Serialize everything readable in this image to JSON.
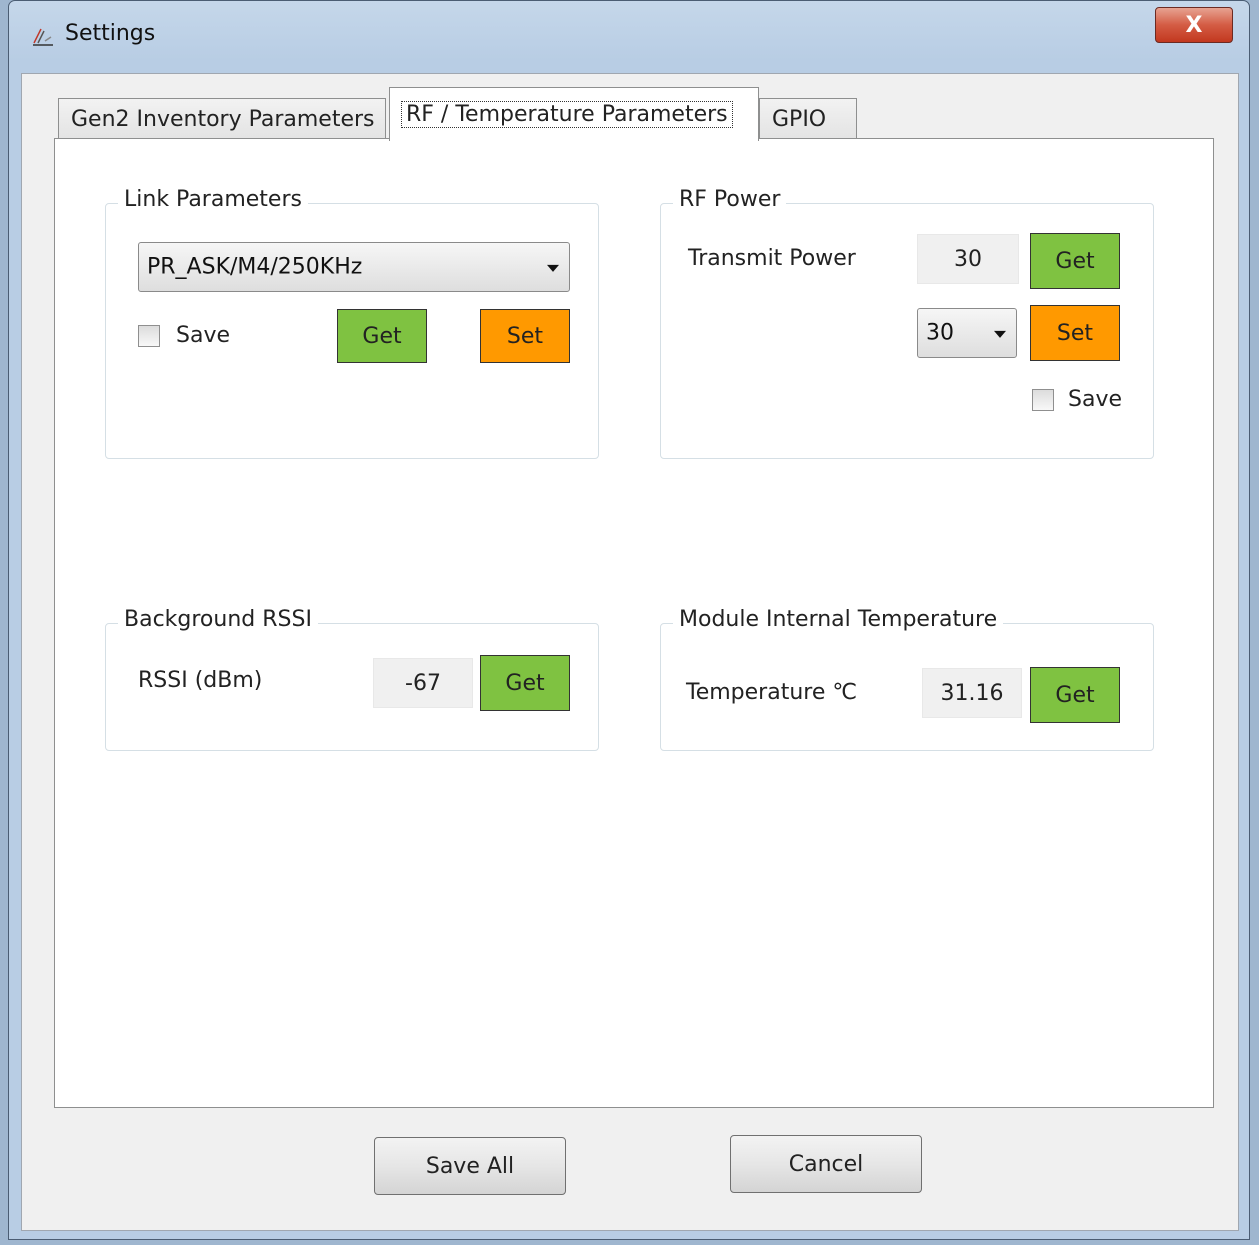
{
  "window": {
    "title": "Settings",
    "close_label": "X"
  },
  "tabs": [
    {
      "label": "Gen2 Inventory Parameters",
      "active": false
    },
    {
      "label": "RF / Temperature Parameters",
      "active": true
    },
    {
      "label": "GPIO",
      "active": false
    }
  ],
  "link_parameters": {
    "title": "Link Parameters",
    "selected": "PR_ASK/M4/250KHz",
    "save_label": "Save",
    "get_label": "Get",
    "set_label": "Set"
  },
  "rf_power": {
    "title": "RF Power",
    "transmit_label": "Transmit Power",
    "current_value": "30",
    "get_label": "Get",
    "selected": "30",
    "set_label": "Set",
    "save_label": "Save"
  },
  "background_rssi": {
    "title": "Background RSSI",
    "label": "RSSI (dBm)",
    "value": "-67",
    "get_label": "Get"
  },
  "module_temperature": {
    "title": "Module Internal Temperature",
    "label": "Temperature ℃",
    "value": "31.16",
    "get_label": "Get"
  },
  "footer": {
    "save_all_label": "Save All",
    "cancel_label": "Cancel"
  },
  "colors": {
    "get_button": "#7fc241",
    "set_button": "#ff9900"
  }
}
